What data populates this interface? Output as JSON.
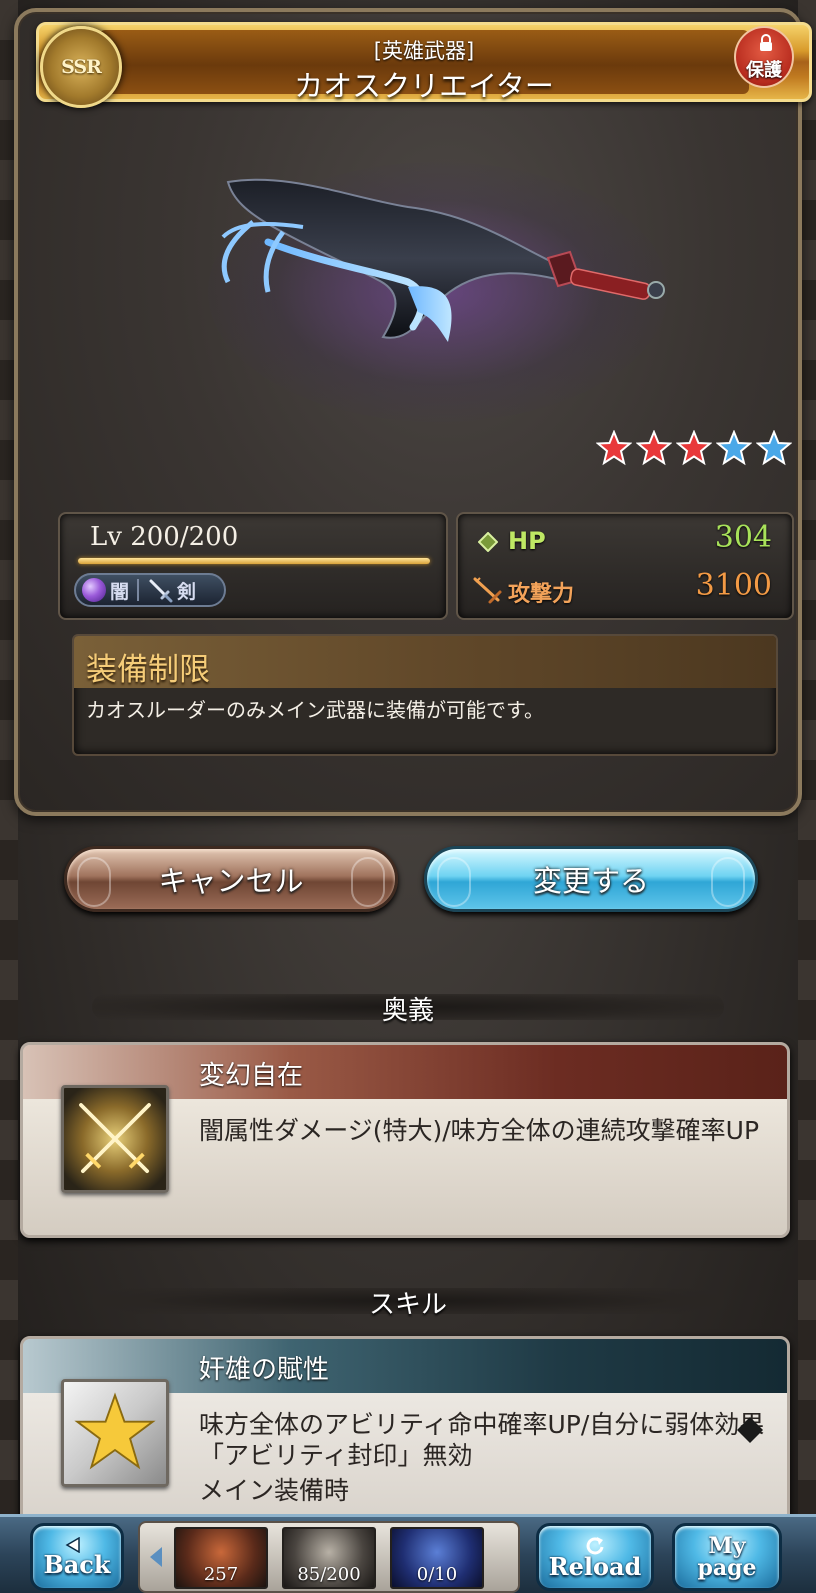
{
  "header": {
    "rarity": "SSR",
    "category": "[英雄武器]",
    "weapon_name": "カオスクリエイター",
    "protect_label": "保護"
  },
  "stars": {
    "filled_red": 3,
    "blue": 2,
    "total": 5
  },
  "level": {
    "text": "Lv 200/200",
    "current": 200,
    "max": 200
  },
  "element": {
    "label": "闇",
    "weapon_type": "剣"
  },
  "stats": {
    "hp_label": "HP",
    "hp_value": "304",
    "atk_label": "攻撃力",
    "atk_value": "3100"
  },
  "restriction": {
    "title": "装備制限",
    "description": "カオスルーダーのみメイン武器に装備が可能です。"
  },
  "buttons": {
    "cancel": "キャンセル",
    "change": "変更する"
  },
  "ougi": {
    "section_title": "奥義",
    "name": "変幻自在",
    "description": "闇属性ダメージ(特大)/味方全体の連続攻撃確率UP"
  },
  "skill": {
    "section_title": "スキル",
    "name": "奸雄の賦性",
    "description": "味方全体のアビリティ命中確率UP/自分に弱体効果「アビリティ封印」無効",
    "note": "メイン装備時"
  },
  "nav": {
    "back": "Back",
    "reload": "Reload",
    "mypage_line1": "My",
    "mypage_line2": "page",
    "crystal": "257",
    "ap": "85/200",
    "bp": "0/10"
  },
  "colors": {
    "title_gold": "#d89a2b",
    "hp_green": "#a8e25a",
    "atk_orange": "#f39a45",
    "change_button_blue": "#2fa6d6",
    "cancel_button_brown": "#6f4634"
  }
}
